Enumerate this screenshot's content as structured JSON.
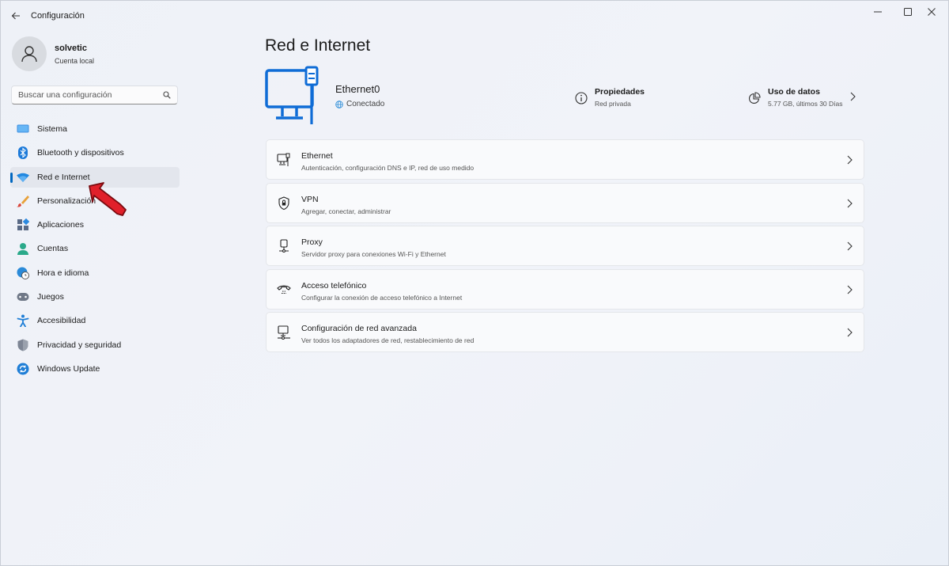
{
  "window": {
    "title": "Configuración",
    "controls": [
      "minimize-icon",
      "maximize-icon",
      "close-icon"
    ]
  },
  "profile": {
    "name": "solvetic",
    "subtitle": "Cuenta local"
  },
  "search": {
    "placeholder": "Buscar una configuración"
  },
  "sidebar": {
    "items": [
      {
        "label": "Sistema",
        "icon": "system-icon"
      },
      {
        "label": "Bluetooth y dispositivos",
        "icon": "bluetooth-icon"
      },
      {
        "label": "Red e Internet",
        "icon": "wifi-icon",
        "active": true
      },
      {
        "label": "Personalización",
        "icon": "brush-icon"
      },
      {
        "label": "Aplicaciones",
        "icon": "apps-icon"
      },
      {
        "label": "Cuentas",
        "icon": "person-icon"
      },
      {
        "label": "Hora e idioma",
        "icon": "globe-clock-icon"
      },
      {
        "label": "Juegos",
        "icon": "gamepad-icon"
      },
      {
        "label": "Accesibilidad",
        "icon": "accessibility-icon"
      },
      {
        "label": "Privacidad y seguridad",
        "icon": "shield-icon"
      },
      {
        "label": "Windows Update",
        "icon": "update-icon"
      }
    ]
  },
  "main": {
    "title": "Red e Internet",
    "connection": {
      "name": "Ethernet0",
      "status": "Conectado"
    },
    "properties": {
      "title": "Propiedades",
      "subtitle": "Red privada"
    },
    "data_usage": {
      "title": "Uso de datos",
      "subtitle": "5.77 GB, últimos 30 Días"
    },
    "cards": [
      {
        "title": "Ethernet",
        "subtitle": "Autenticación, configuración DNS e IP, red de uso medido",
        "icon": "ethernet-icon"
      },
      {
        "title": "VPN",
        "subtitle": "Agregar, conectar, administrar",
        "icon": "vpn-shield-icon"
      },
      {
        "title": "Proxy",
        "subtitle": "Servidor proxy para conexiones Wi-Fi y Ethernet",
        "icon": "proxy-icon"
      },
      {
        "title": "Acceso telefónico",
        "subtitle": "Configurar la conexión de acceso telefónico a Internet",
        "icon": "dialup-icon"
      },
      {
        "title": "Configuración de red avanzada",
        "subtitle": "Ver todos los adaptadores de red, restablecimiento de red",
        "icon": "advanced-network-icon"
      }
    ]
  },
  "colors": {
    "accent": "#0067c0",
    "pointer": "#e0202a"
  }
}
